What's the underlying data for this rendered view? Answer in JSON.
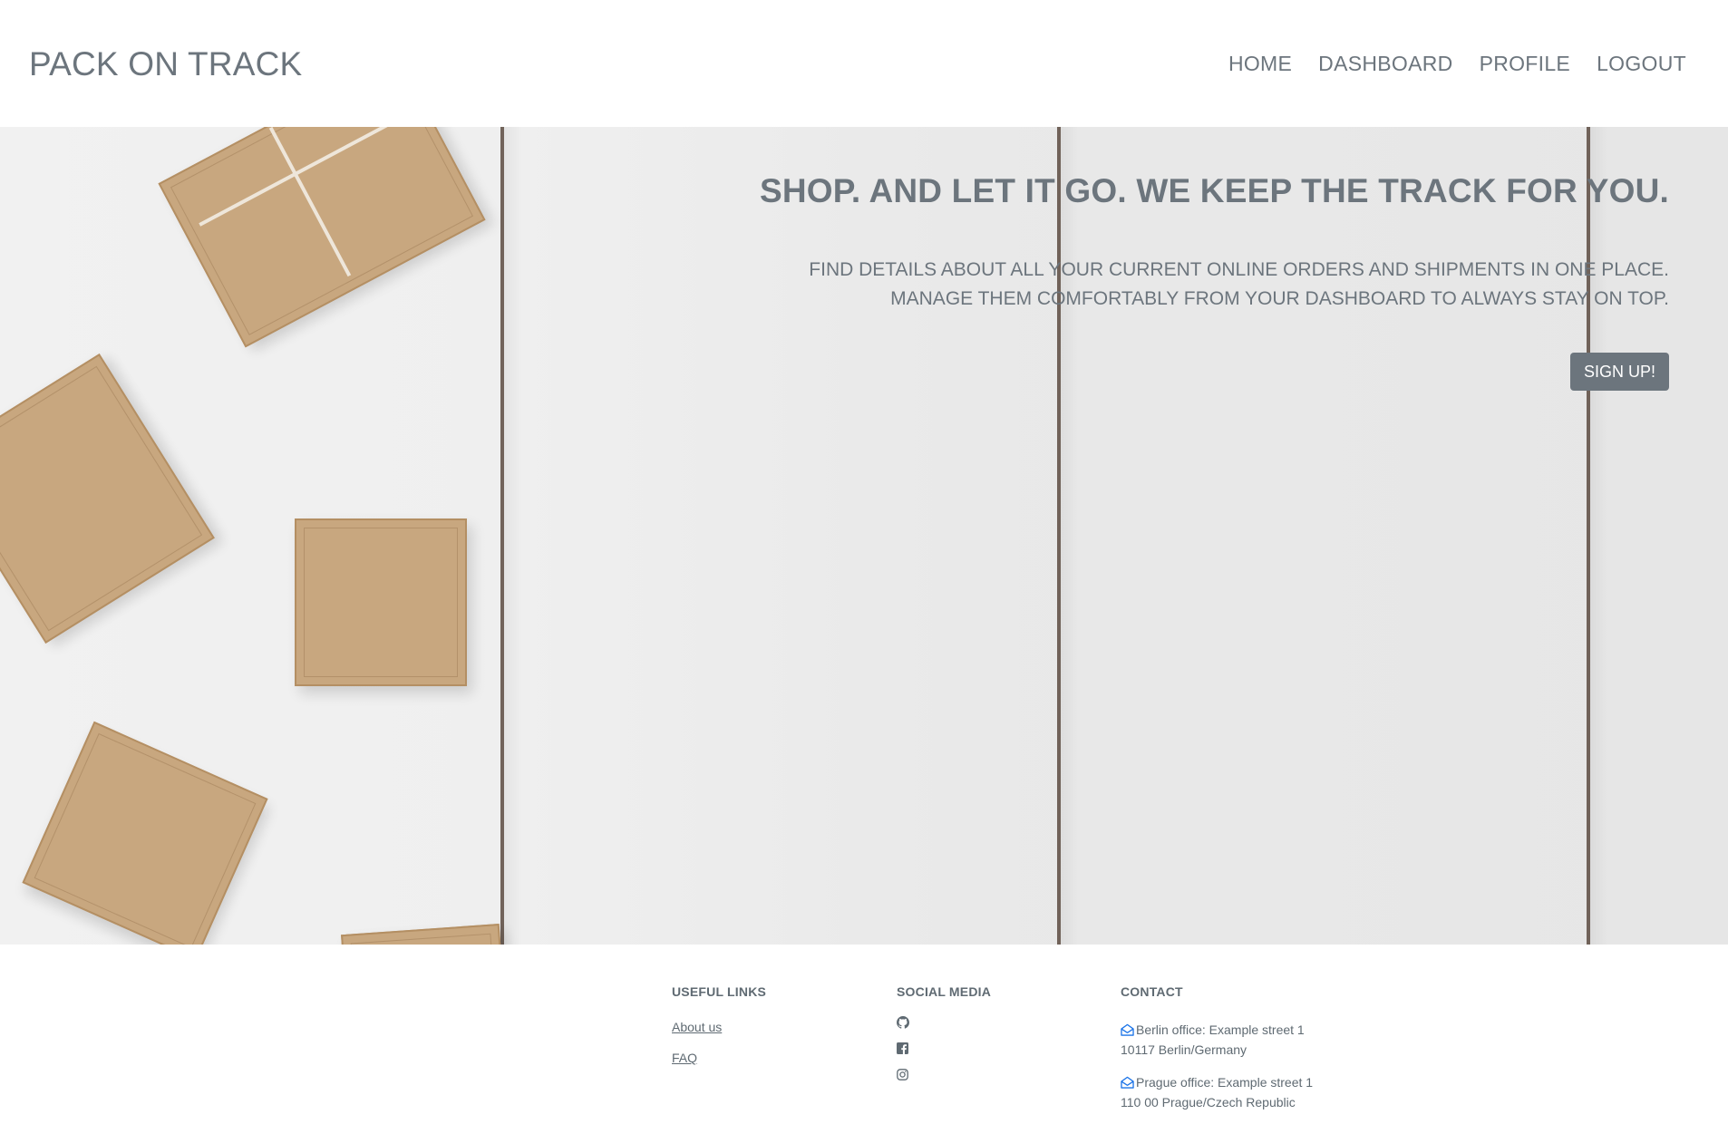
{
  "navbar": {
    "brand": "PACK ON TRACK",
    "links": [
      "HOME",
      "DASHBOARD",
      "PROFILE",
      "LOGOUT"
    ]
  },
  "hero": {
    "title": "SHOP. AND LET IT GO. WE KEEP THE TRACK FOR YOU.",
    "text_line1": "FIND DETAILS ABOUT ALL YOUR CURRENT ONLINE ORDERS AND SHIPMENTS IN ONE PLACE.",
    "text_line2": "MANAGE THEM COMFORTABLY FROM YOUR DASHBOARD TO ALWAYS STAY ON TOP.",
    "cta_label": "SIGN UP!"
  },
  "footer": {
    "useful_links": {
      "heading": "USEFUL LINKS",
      "links": [
        "About us",
        "FAQ"
      ]
    },
    "social_media": {
      "heading": "SOCIAL MEDIA",
      "icons": [
        "github-icon",
        "facebook-icon",
        "instagram-icon"
      ]
    },
    "contact": {
      "heading": "CONTACT",
      "offices": [
        {
          "line1": "Berlin office: Example street 1",
          "line2": "10117 Berlin/Germany"
        },
        {
          "line1": "Prague office: Example street 1",
          "line2": "110 00 Prague/Czech Republic"
        }
      ],
      "icon_color": "#1a73e8"
    }
  },
  "colors": {
    "text": "#6c757d",
    "button": "#6c757d"
  }
}
